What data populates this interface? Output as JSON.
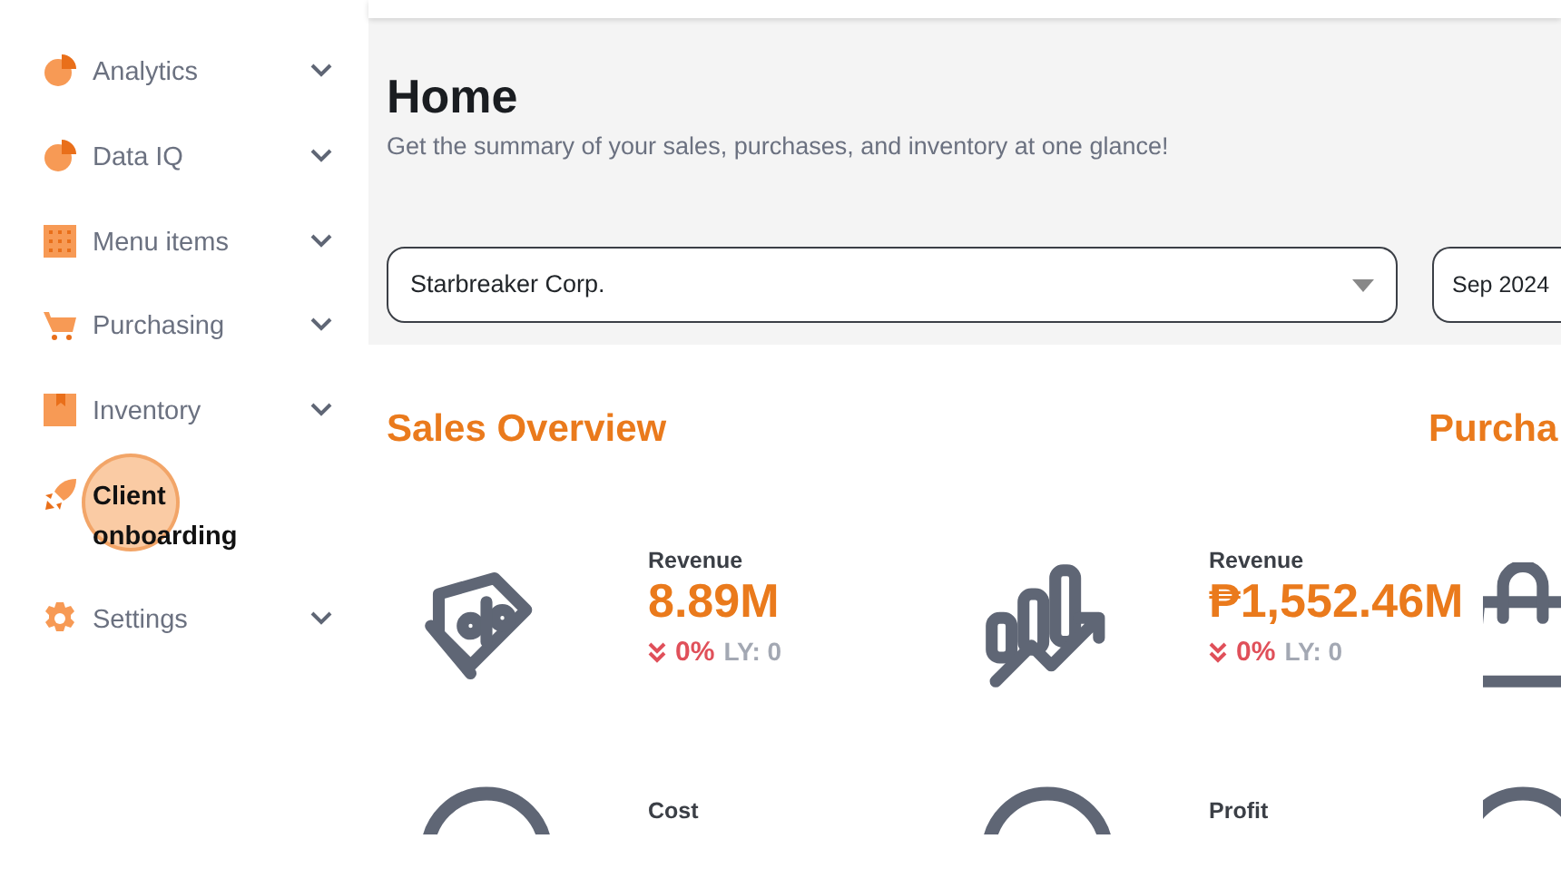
{
  "sidebar": {
    "items": [
      {
        "label": "Analytics",
        "kind": "pie",
        "expandable": true,
        "selected": false
      },
      {
        "label": "Data IQ",
        "kind": "pie",
        "expandable": true,
        "selected": false
      },
      {
        "label": "Menu items",
        "kind": "grid",
        "expandable": true,
        "selected": false
      },
      {
        "label": "Purchasing",
        "kind": "cart",
        "expandable": true,
        "selected": false
      },
      {
        "label": "Inventory",
        "kind": "box",
        "expandable": true,
        "selected": false
      },
      {
        "label": "Client onboarding",
        "kind": "rocket",
        "expandable": false,
        "selected": true
      },
      {
        "label": "Settings",
        "kind": "gear",
        "expandable": true,
        "selected": false
      }
    ]
  },
  "header": {
    "title": "Home",
    "subtitle": "Get the summary of your sales, purchases, and inventory at one glance!"
  },
  "filters": {
    "company": "Starbreaker Corp.",
    "period": "Sep 2024"
  },
  "sections": [
    {
      "title": "Sales Overview",
      "stats": [
        {
          "label": "Revenue",
          "kind": "tag",
          "value": "8.89M",
          "change": "0%",
          "last_year": "LY: 0"
        },
        {
          "label": "Revenue",
          "kind": "chart",
          "value": "₱1,552.46M",
          "change": "0%",
          "last_year": "LY: 0"
        },
        {
          "label": "Cost",
          "kind": "circle"
        },
        {
          "label": "Profit",
          "kind": "circle"
        }
      ]
    },
    {
      "title": "Purcha",
      "stats": [
        {
          "kind": "bag"
        },
        {
          "kind": "circle"
        }
      ]
    }
  ]
}
